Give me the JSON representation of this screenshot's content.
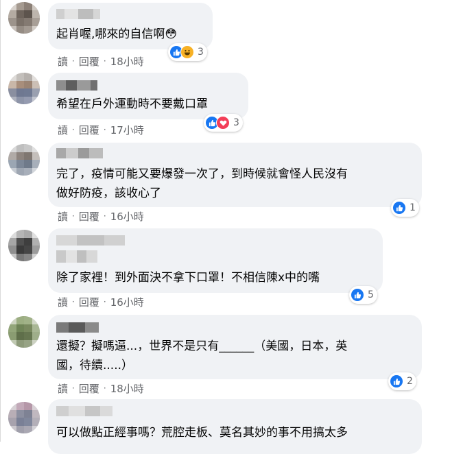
{
  "colors": {
    "bubble": "#f0f2f5",
    "meta_text": "#65676b",
    "like_blue": "#1877f2",
    "love_red": "#f33e58",
    "haha_yellow": "#f7b125"
  },
  "comments": [
    {
      "text": "起肖喔,哪來的自信啊😳",
      "actions": {
        "read": "讀",
        "reply": "回覆",
        "time": "18小時"
      },
      "reactions": {
        "icons": [
          "like-icon",
          "haha-icon"
        ],
        "count": "3"
      }
    },
    {
      "text": "希望在戶外運動時不要戴口罩",
      "actions": {
        "read": "讀",
        "reply": "回覆",
        "time": "17小時"
      },
      "reactions": {
        "icons": [
          "like-icon",
          "love-icon"
        ],
        "count": "3"
      }
    },
    {
      "text": "完了，疫情可能又要爆發一次了，到時候就會怪人民沒有\n做好防疫，該收心了",
      "actions": {
        "read": "讀",
        "reply": "回覆",
        "time": "16小時"
      },
      "reactions": {
        "icons": [
          "like-icon"
        ],
        "count": "1"
      }
    },
    {
      "text": "除了家裡！到外面決不拿下口罩！不相信陳x中的嘴",
      "actions": {
        "read": "讀",
        "reply": "回覆",
        "time": "16小時"
      },
      "reactions": {
        "icons": [
          "like-icon"
        ],
        "count": "5"
      }
    },
    {
      "text": "還擬？擬嗎逼...，世界不是只有______（美國，日本，英\n國，待續.....）",
      "actions": {
        "read": "讀",
        "reply": "回覆",
        "time": "18小時"
      },
      "reactions": {
        "icons": [
          "like-icon"
        ],
        "count": "2"
      }
    },
    {
      "text": "可以做點正經事嗎？荒腔走板、莫名其妙的事不用搞太多",
      "actions": {
        "read": "",
        "reply": "",
        "time": ""
      },
      "reactions": {
        "icons": [],
        "count": ""
      }
    }
  ]
}
